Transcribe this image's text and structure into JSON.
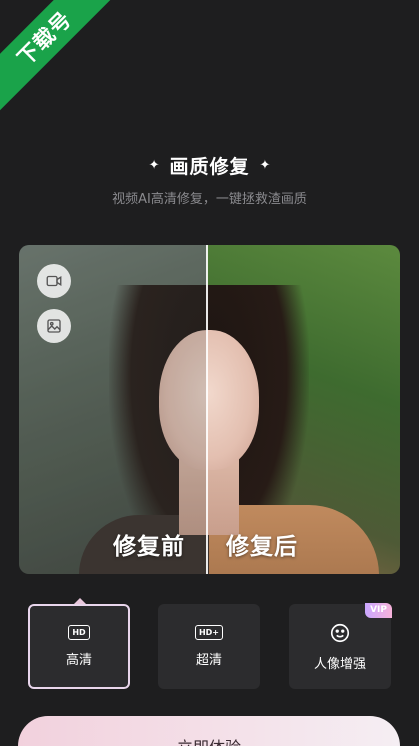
{
  "watermark": {
    "text": "下载号",
    "color": "#1aa34a"
  },
  "header": {
    "title": "画质修复",
    "sparkle_left": "✦",
    "sparkle_right": "✦",
    "subtitle": "视频AI高清修复，一键拯救渣画质"
  },
  "compare": {
    "before_label": "修复前",
    "after_label": "修复后",
    "side_buttons": [
      {
        "icon": "video-camera-icon"
      },
      {
        "icon": "image-icon"
      }
    ]
  },
  "options": [
    {
      "icon": "hd-icon",
      "icon_text": "HD",
      "label": "高清",
      "selected": true,
      "vip": false
    },
    {
      "icon": "hd-plus-icon",
      "icon_text": "HD+",
      "label": "超清",
      "selected": false,
      "vip": false
    },
    {
      "icon": "smile-face-icon",
      "label": "人像增强",
      "selected": false,
      "vip": true,
      "badge": "VIP"
    }
  ],
  "cta": {
    "label": "立即体验"
  },
  "colors": {
    "background": "#1e1e1f",
    "card": "#2c2c2e",
    "selected_border": "#e9d6ec",
    "cta_gradient_start": "#f2d1dd"
  }
}
